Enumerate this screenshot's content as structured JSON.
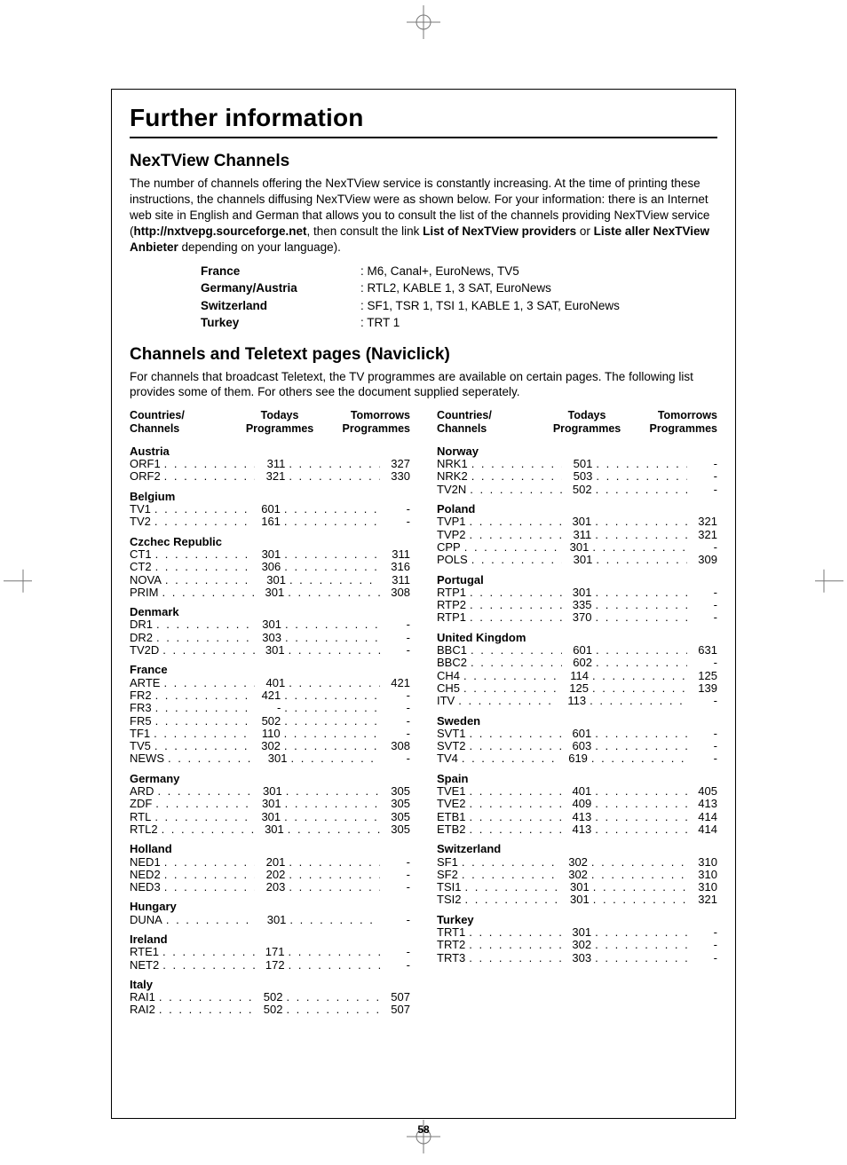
{
  "page_number": "58",
  "title": "Further information",
  "section1": {
    "heading": "NexTView Channels",
    "para": "The number of channels offering the NexTView service is constantly increasing. At the time of printing these instructions, the channels diffusing NexTView were as shown below. For your information: there is an Internet web site in English and German that allows you to consult the list of the channels providing NexTView service (",
    "url": "http://nxtvepg.sourceforge.net",
    "para_tail": ", then consult the link ",
    "link1": "List of NexTView providers",
    "or": " or ",
    "link2": "Liste aller NexTView Anbieter",
    "para_end": " depending on your language).",
    "providers": [
      {
        "label": "France",
        "value": ": M6, Canal+, EuroNews, TV5"
      },
      {
        "label": "Germany/Austria",
        "value": ": RTL2, KABLE 1, 3 SAT, EuroNews"
      },
      {
        "label": "Switzerland",
        "value": ": SF1, TSR 1, TSI 1, KABLE 1, 3 SAT, EuroNews"
      },
      {
        "label": "Turkey",
        "value": ": TRT 1"
      }
    ]
  },
  "section2": {
    "heading": "Channels and Teletext pages (Naviclick)",
    "intro": "For channels that broadcast Teletext, the TV programmes are available on certain pages. The following list provides some of them. For others see the document supplied seperately.",
    "head_c1a": "Countries/",
    "head_c1b": "Channels",
    "head_c2a": "Todays",
    "head_c2b": "Programmes",
    "head_c3a": "Tomorrows",
    "head_c3b": "Programmes"
  },
  "left": [
    {
      "country": "Austria",
      "rows": [
        {
          "n": "ORF1",
          "a": "311",
          "b": "327"
        },
        {
          "n": "ORF2",
          "a": "321",
          "b": "330"
        }
      ]
    },
    {
      "country": "Belgium",
      "rows": [
        {
          "n": "TV1",
          "a": "601",
          "b": "-"
        },
        {
          "n": "TV2",
          "a": "161",
          "b": "-"
        }
      ]
    },
    {
      "country": "Czchec Republic",
      "rows": [
        {
          "n": "CT1",
          "a": "301",
          "b": "311"
        },
        {
          "n": "CT2",
          "a": "306",
          "b": "316"
        },
        {
          "n": "NOVA",
          "a": "301",
          "b": "311"
        },
        {
          "n": "PRIM",
          "a": "301",
          "b": "308"
        }
      ]
    },
    {
      "country": "Denmark",
      "rows": [
        {
          "n": "DR1",
          "a": "301",
          "b": "-"
        },
        {
          "n": "DR2",
          "a": "303",
          "b": "-"
        },
        {
          "n": "TV2D",
          "a": "301",
          "b": "-"
        }
      ]
    },
    {
      "country": "France",
      "rows": [
        {
          "n": "ARTE",
          "a": "401",
          "b": "421"
        },
        {
          "n": "FR2",
          "a": "421",
          "b": "-"
        },
        {
          "n": "FR3",
          "a": "-",
          "b": "-"
        },
        {
          "n": "FR5",
          "a": "502",
          "b": "-"
        },
        {
          "n": "TF1",
          "a": "110",
          "b": "-"
        },
        {
          "n": "TV5",
          "a": "302",
          "b": "308"
        },
        {
          "n": "NEWS",
          "a": "301",
          "b": "-"
        }
      ]
    },
    {
      "country": "Germany",
      "rows": [
        {
          "n": "ARD",
          "a": "301",
          "b": "305"
        },
        {
          "n": "ZDF",
          "a": "301",
          "b": "305"
        },
        {
          "n": "RTL",
          "a": "301",
          "b": "305"
        },
        {
          "n": "RTL2",
          "a": "301",
          "b": "305"
        }
      ]
    },
    {
      "country": "Holland",
      "rows": [
        {
          "n": "NED1",
          "a": "201",
          "b": "-"
        },
        {
          "n": "NED2",
          "a": "202",
          "b": "-"
        },
        {
          "n": "NED3",
          "a": "203",
          "b": "-"
        }
      ]
    },
    {
      "country": "Hungary",
      "rows": [
        {
          "n": "DUNA",
          "a": "301",
          "b": "-"
        }
      ]
    },
    {
      "country": "Ireland",
      "rows": [
        {
          "n": "RTE1",
          "a": "171",
          "b": "-"
        },
        {
          "n": "NET2",
          "a": "172",
          "b": "-"
        }
      ]
    },
    {
      "country": "Italy",
      "rows": [
        {
          "n": "RAI1",
          "a": "502",
          "b": "507"
        },
        {
          "n": "RAI2",
          "a": "502",
          "b": "507"
        }
      ]
    }
  ],
  "right": [
    {
      "country": "Norway",
      "rows": [
        {
          "n": "NRK1",
          "a": "501",
          "b": "-"
        },
        {
          "n": "NRK2",
          "a": "503",
          "b": "-"
        },
        {
          "n": "TV2N",
          "a": "502",
          "b": "-"
        }
      ]
    },
    {
      "country": "Poland",
      "rows": [
        {
          "n": "TVP1",
          "a": "301",
          "b": "321"
        },
        {
          "n": "TVP2",
          "a": "311",
          "b": "321"
        },
        {
          "n": "CPP",
          "a": "301",
          "b": "-"
        },
        {
          "n": "POLS",
          "a": "301",
          "b": "309"
        }
      ]
    },
    {
      "country": "Portugal",
      "rows": [
        {
          "n": "RTP1",
          "a": "301",
          "b": "-"
        },
        {
          "n": "RTP2",
          "a": "335",
          "b": "-"
        },
        {
          "n": "RTP1",
          "a": "370",
          "b": "-"
        }
      ]
    },
    {
      "country": "United Kingdom",
      "rows": [
        {
          "n": "BBC1",
          "a": "601",
          "b": "631"
        },
        {
          "n": "BBC2",
          "a": "602",
          "b": "-"
        },
        {
          "n": "CH4",
          "a": "114",
          "b": "125"
        },
        {
          "n": "CH5",
          "a": "125",
          "b": "139"
        },
        {
          "n": "ITV",
          "a": "113",
          "b": "-"
        }
      ]
    },
    {
      "country": "Sweden",
      "rows": [
        {
          "n": "SVT1",
          "a": "601",
          "b": "-"
        },
        {
          "n": "SVT2",
          "a": "603",
          "b": "-"
        },
        {
          "n": "TV4",
          "a": "619",
          "b": "-"
        }
      ]
    },
    {
      "country": "Spain",
      "rows": [
        {
          "n": "TVE1",
          "a": "401",
          "b": "405"
        },
        {
          "n": "TVE2",
          "a": "409",
          "b": "413"
        },
        {
          "n": "ETB1",
          "a": "413",
          "b": "414"
        },
        {
          "n": "ETB2",
          "a": "413",
          "b": "414"
        }
      ]
    },
    {
      "country": "Switzerland",
      "rows": [
        {
          "n": "SF1",
          "a": "302",
          "b": "310"
        },
        {
          "n": "SF2",
          "a": "302",
          "b": "310"
        },
        {
          "n": "TSI1",
          "a": "301",
          "b": "310"
        },
        {
          "n": "TSI2",
          "a": "301",
          "b": "321"
        }
      ]
    },
    {
      "country": "Turkey",
      "rows": [
        {
          "n": "TRT1",
          "a": "301",
          "b": "-"
        },
        {
          "n": "TRT2",
          "a": "302",
          "b": "-"
        },
        {
          "n": "TRT3",
          "a": "303",
          "b": "-"
        }
      ]
    }
  ]
}
